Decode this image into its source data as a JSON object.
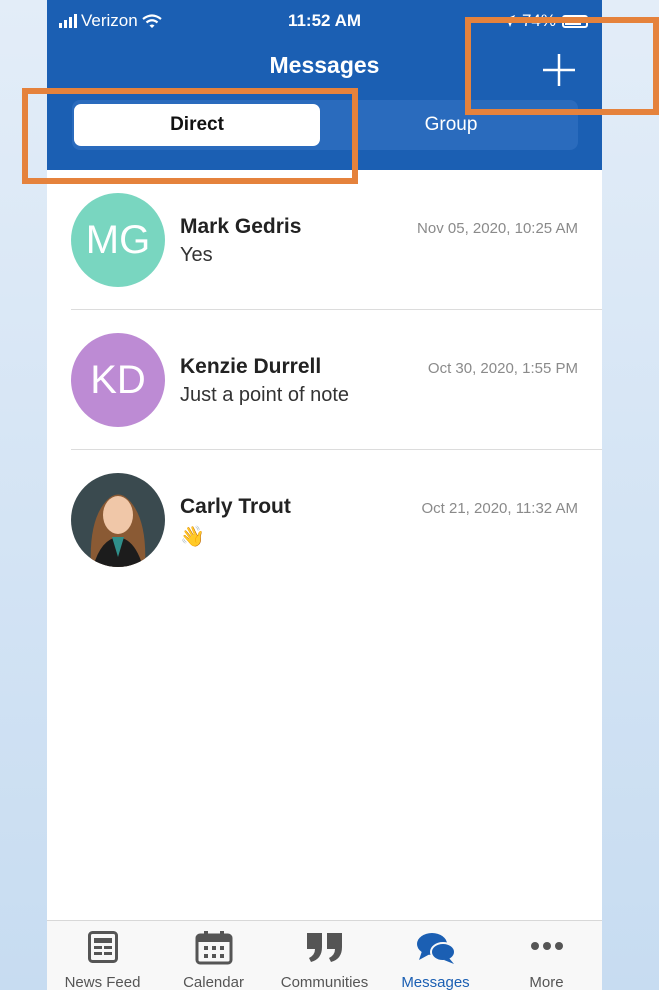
{
  "status_bar": {
    "carrier": "Verizon",
    "time": "11:52 AM",
    "battery": "74%",
    "battery_level": 0.74
  },
  "header": {
    "title": "Messages",
    "new_message_icon": "plus-icon"
  },
  "segments": {
    "direct_label": "Direct",
    "group_label": "Group",
    "selected": "Direct"
  },
  "conversations": [
    {
      "name": "Mark Gedris",
      "initials": "MG",
      "preview": "Yes",
      "timestamp": "Nov 05, 2020, 10:25 AM",
      "avatar_color": "#79d6c0"
    },
    {
      "name": "Kenzie Durrell",
      "initials": "KD",
      "preview": "Just a point of note",
      "timestamp": "Oct 30, 2020, 1:55 PM",
      "avatar_color": "#bd8bd4"
    },
    {
      "name": "Carly Trout",
      "initials": "",
      "preview": "👋",
      "timestamp": "Oct 21, 2020, 11:32 AM",
      "avatar_color": "#2d3a3f"
    }
  ],
  "tabbar": {
    "items": [
      {
        "label": "News Feed",
        "icon": "news-feed-icon"
      },
      {
        "label": "Calendar",
        "icon": "calendar-icon"
      },
      {
        "label": "Communities",
        "icon": "quote-icon"
      },
      {
        "label": "Messages",
        "icon": "chat-bubbles-icon"
      },
      {
        "label": "More",
        "icon": "more-dots-icon"
      }
    ],
    "active": "Messages"
  },
  "colors": {
    "header_blue": "#1b5fb3",
    "highlight_orange": "#e5823c"
  }
}
